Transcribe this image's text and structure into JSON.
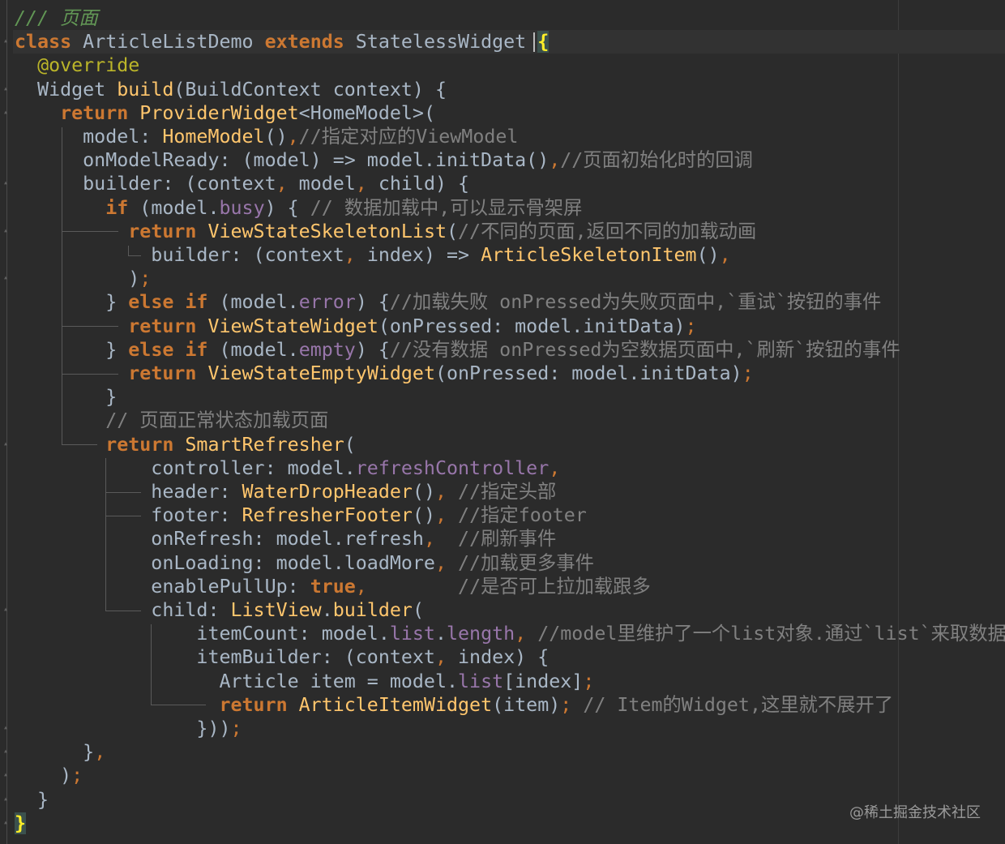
{
  "editor": {
    "language": "Dart",
    "theme": "Darcula",
    "lines": [
      [
        {
          "t": "/// 页面",
          "c": "comment-green"
        }
      ],
      [
        {
          "t": "class",
          "c": "kw"
        },
        {
          "t": " ArticleListDemo ",
          "c": "plain"
        },
        {
          "t": "extends",
          "c": "kw"
        },
        {
          "t": " StatelessWidget ",
          "c": "plain"
        },
        {
          "t": "{",
          "c": "brace-hl"
        }
      ],
      [
        {
          "t": "  "
        },
        {
          "t": "@override",
          "c": "annot"
        }
      ],
      [
        {
          "t": "  Widget "
        },
        {
          "t": "build",
          "c": "fn"
        },
        {
          "t": "(BuildContext context) {"
        }
      ],
      [
        {
          "t": "    "
        },
        {
          "t": "return",
          "c": "kw"
        },
        {
          "t": " "
        },
        {
          "t": "ProviderWidget",
          "c": "fn"
        },
        {
          "t": "<HomeModel>("
        }
      ],
      [
        {
          "t": "      model: "
        },
        {
          "t": "HomeModel",
          "c": "fn"
        },
        {
          "t": "()"
        },
        {
          "t": ",",
          "c": "punct"
        },
        {
          "t": "//指定对应的ViewModel",
          "c": "comment"
        }
      ],
      [
        {
          "t": "      onModelReady: (model) => model.initData()"
        },
        {
          "t": ",",
          "c": "punct"
        },
        {
          "t": "//页面初始化时的回调",
          "c": "comment"
        }
      ],
      [
        {
          "t": "      builder: (context"
        },
        {
          "t": ",",
          "c": "punct"
        },
        {
          "t": " model"
        },
        {
          "t": ",",
          "c": "punct"
        },
        {
          "t": " child) {"
        }
      ],
      [
        {
          "t": "        "
        },
        {
          "t": "if",
          "c": "kw"
        },
        {
          "t": " (model."
        },
        {
          "t": "busy",
          "c": "field"
        },
        {
          "t": ") { "
        },
        {
          "t": "// 数据加载中,可以显示骨架屏",
          "c": "comment"
        }
      ],
      [
        {
          "t": "          "
        },
        {
          "t": "return",
          "c": "kw"
        },
        {
          "t": " "
        },
        {
          "t": "ViewStateSkeletonList",
          "c": "fn"
        },
        {
          "t": "("
        },
        {
          "t": "//不同的页面,返回不同的加载动画",
          "c": "comment"
        }
      ],
      [
        {
          "t": "            builder: (context"
        },
        {
          "t": ",",
          "c": "punct"
        },
        {
          "t": " index) => "
        },
        {
          "t": "ArticleSkeletonItem",
          "c": "fn"
        },
        {
          "t": "()"
        },
        {
          "t": ",",
          "c": "punct"
        }
      ],
      [
        {
          "t": "          )"
        },
        {
          "t": ";",
          "c": "punct"
        }
      ],
      [
        {
          "t": "        } "
        },
        {
          "t": "else",
          "c": "kw"
        },
        {
          "t": " "
        },
        {
          "t": "if",
          "c": "kw"
        },
        {
          "t": " (model."
        },
        {
          "t": "error",
          "c": "field"
        },
        {
          "t": ") {"
        },
        {
          "t": "//加载失败 onPressed为失败页面中,`重试`按钮的事件",
          "c": "comment"
        }
      ],
      [
        {
          "t": "          "
        },
        {
          "t": "return",
          "c": "kw"
        },
        {
          "t": " "
        },
        {
          "t": "ViewStateWidget",
          "c": "fn"
        },
        {
          "t": "(onPressed: model.initData)"
        },
        {
          "t": ";",
          "c": "punct"
        }
      ],
      [
        {
          "t": "        } "
        },
        {
          "t": "else",
          "c": "kw"
        },
        {
          "t": " "
        },
        {
          "t": "if",
          "c": "kw"
        },
        {
          "t": " (model."
        },
        {
          "t": "empty",
          "c": "field"
        },
        {
          "t": ") {"
        },
        {
          "t": "//没有数据 onPressed为空数据页面中,`刷新`按钮的事件",
          "c": "comment"
        }
      ],
      [
        {
          "t": "          "
        },
        {
          "t": "return",
          "c": "kw"
        },
        {
          "t": " "
        },
        {
          "t": "ViewStateEmptyWidget",
          "c": "fn"
        },
        {
          "t": "(onPressed: model.initData)"
        },
        {
          "t": ";",
          "c": "punct"
        }
      ],
      [
        {
          "t": "        }"
        }
      ],
      [
        {
          "t": "        "
        },
        {
          "t": "// 页面正常状态加载页面",
          "c": "comment"
        }
      ],
      [
        {
          "t": "        "
        },
        {
          "t": "return",
          "c": "kw"
        },
        {
          "t": " "
        },
        {
          "t": "SmartRefresher",
          "c": "fn"
        },
        {
          "t": "("
        }
      ],
      [
        {
          "t": "            controller: model."
        },
        {
          "t": "refreshController",
          "c": "field"
        },
        {
          "t": ",",
          "c": "punct"
        }
      ],
      [
        {
          "t": "            header: "
        },
        {
          "t": "WaterDropHeader",
          "c": "fn"
        },
        {
          "t": "()"
        },
        {
          "t": ",",
          "c": "punct"
        },
        {
          "t": " "
        },
        {
          "t": "//指定头部",
          "c": "comment"
        }
      ],
      [
        {
          "t": "            footer: "
        },
        {
          "t": "RefresherFooter",
          "c": "fn"
        },
        {
          "t": "()"
        },
        {
          "t": ",",
          "c": "punct"
        },
        {
          "t": " "
        },
        {
          "t": "//指定footer",
          "c": "comment"
        }
      ],
      [
        {
          "t": "            onRefresh: model.refresh"
        },
        {
          "t": ",",
          "c": "punct"
        },
        {
          "t": "  "
        },
        {
          "t": "//刷新事件",
          "c": "comment"
        }
      ],
      [
        {
          "t": "            onLoading: model.loadMore"
        },
        {
          "t": ",",
          "c": "punct"
        },
        {
          "t": " "
        },
        {
          "t": "//加载更多事件",
          "c": "comment"
        }
      ],
      [
        {
          "t": "            enablePullUp: "
        },
        {
          "t": "true",
          "c": "kw"
        },
        {
          "t": ",",
          "c": "punct"
        },
        {
          "t": "        "
        },
        {
          "t": "//是否可上拉加载跟多",
          "c": "comment"
        }
      ],
      [
        {
          "t": "            child: "
        },
        {
          "t": "ListView",
          "c": "fn"
        },
        {
          "t": "."
        },
        {
          "t": "builder",
          "c": "fn"
        },
        {
          "t": "("
        }
      ],
      [
        {
          "t": "                itemCount: model."
        },
        {
          "t": "list",
          "c": "field"
        },
        {
          "t": "."
        },
        {
          "t": "length",
          "c": "field"
        },
        {
          "t": ",",
          "c": "punct"
        },
        {
          "t": " "
        },
        {
          "t": "//model里维护了一个list对象.通过`list`来取数据",
          "c": "comment"
        }
      ],
      [
        {
          "t": "                itemBuilder: (context"
        },
        {
          "t": ",",
          "c": "punct"
        },
        {
          "t": " index) {"
        }
      ],
      [
        {
          "t": "                  Article item = model."
        },
        {
          "t": "list",
          "c": "field"
        },
        {
          "t": "[index]"
        },
        {
          "t": ";",
          "c": "punct"
        }
      ],
      [
        {
          "t": "                  "
        },
        {
          "t": "return",
          "c": "kw"
        },
        {
          "t": " "
        },
        {
          "t": "ArticleItemWidget",
          "c": "fn"
        },
        {
          "t": "(item)"
        },
        {
          "t": ";",
          "c": "punct"
        },
        {
          "t": " "
        },
        {
          "t": "// Item的Widget,这里就不展开了",
          "c": "comment"
        }
      ],
      [
        {
          "t": "                }))"
        },
        {
          "t": ";",
          "c": "punct"
        }
      ],
      [
        {
          "t": "      }"
        },
        {
          "t": ",",
          "c": "punct"
        }
      ],
      [
        {
          "t": "    )"
        },
        {
          "t": ";",
          "c": "punct"
        }
      ],
      [
        {
          "t": "  }"
        }
      ],
      [
        {
          "t": "}",
          "c": "brace-hl"
        }
      ]
    ]
  },
  "watermark": {
    "text": "@稀土掘金技术社区"
  }
}
